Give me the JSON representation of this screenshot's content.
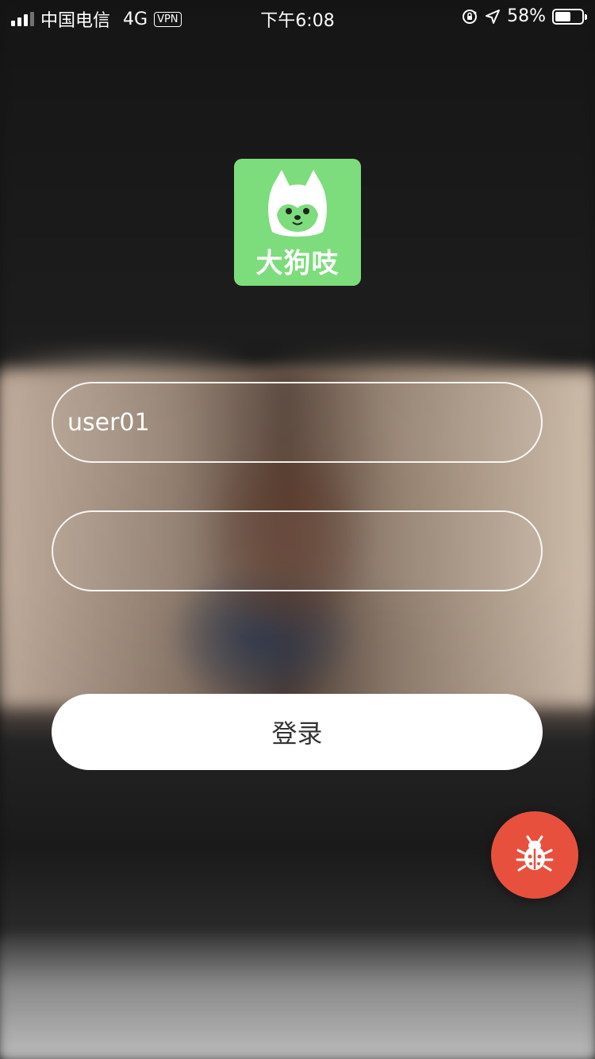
{
  "status_bar": {
    "carrier": "中国电信",
    "network": "4G",
    "vpn": "VPN",
    "time": "下午6:08",
    "battery": "58%",
    "battery_level": 0.58,
    "icons": [
      "signal-icon",
      "orientation-lock-icon",
      "location-icon",
      "battery-icon"
    ]
  },
  "logo": {
    "text": "大狗吱",
    "color": "#7ddc7c"
  },
  "form": {
    "username_value": "user01",
    "password_value": "",
    "login_label": "登录"
  },
  "debug_button": {
    "icon": "bug-icon",
    "color": "#e8503e"
  }
}
